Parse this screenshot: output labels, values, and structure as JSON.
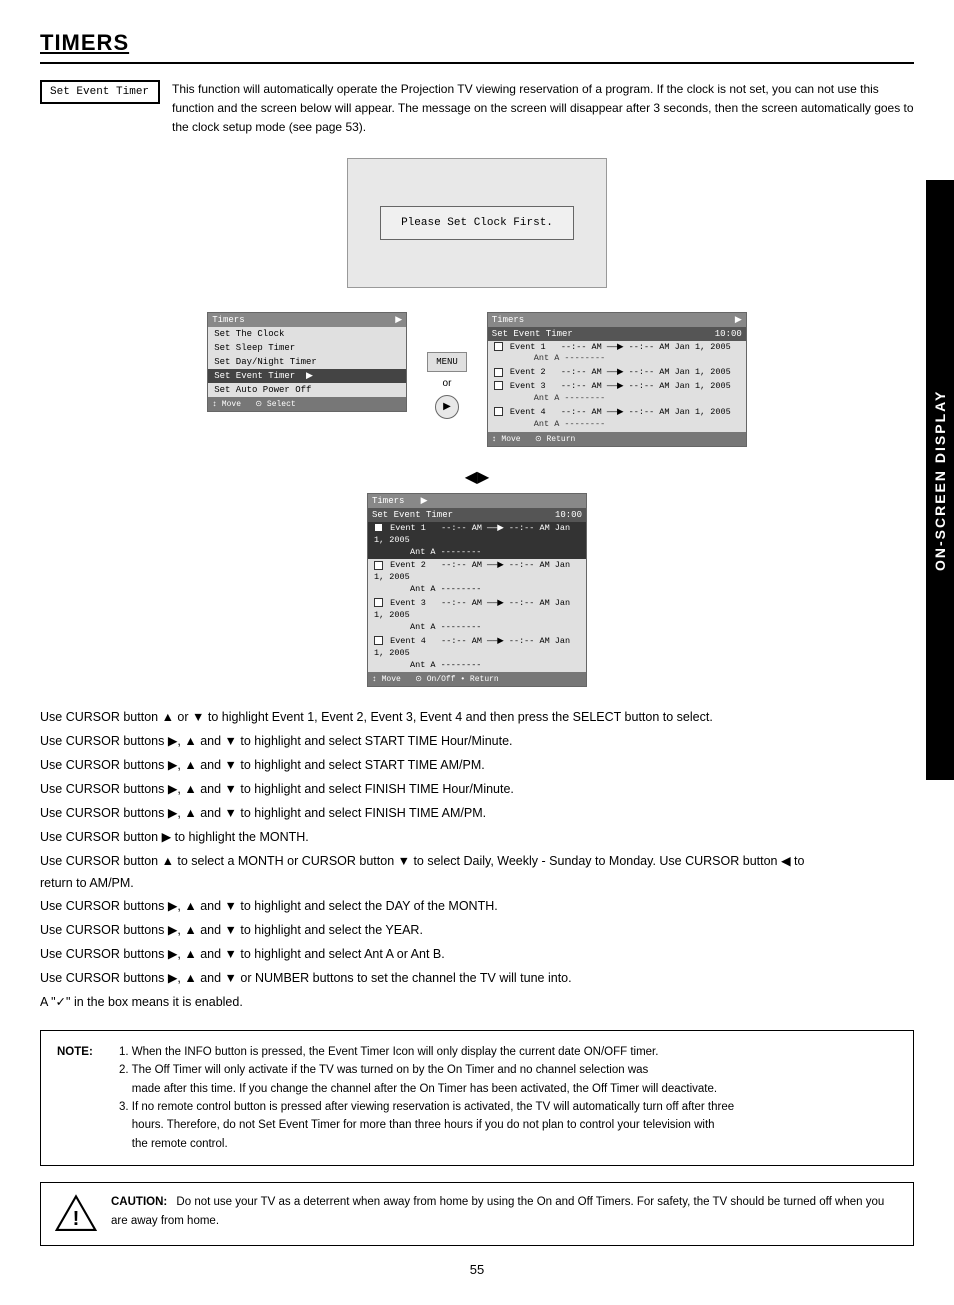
{
  "page": {
    "title": "TIMERS",
    "page_number": "55",
    "right_label": "ON-SCREEN DISPLAY"
  },
  "badge": {
    "label": "Set Event Timer"
  },
  "intro": {
    "text": "This function will automatically operate the Projection TV viewing reservation of a program.  If the clock is not set, you can not use this function and the screen below will appear.  The message on the screen will disappear after 3 seconds, then the screen automatically goes to the clock setup mode (see page 53)."
  },
  "clock_screen": {
    "message": "Please Set Clock First."
  },
  "menu": {
    "title": "Timers",
    "items": [
      {
        "label": "Set The Clock",
        "highlighted": false
      },
      {
        "label": "Set Sleep Timer",
        "highlighted": false
      },
      {
        "label": "Set Day/Night Timer",
        "highlighted": false
      },
      {
        "label": "Set Event Timer",
        "highlighted": true
      },
      {
        "label": "Set Auto Power Off",
        "highlighted": false
      }
    ],
    "bottom": "↕ Move  ⊙ Select"
  },
  "event_timer_right": {
    "title": "Timers",
    "subtitle": "Set Event Timer",
    "time": "10:00",
    "events": [
      {
        "num": 1,
        "time": "--:-- AM ——▶ --:-- AM Jan 1, 2005",
        "ant": "Ant A --------"
      },
      {
        "num": 2,
        "time": "--:-- AM ——▶ --:-- AM Jan 1, 2005",
        "ant": ""
      },
      {
        "num": 3,
        "time": "--:-- AM ——▶ --:-- AM Jan 1, 2005",
        "ant": "Ant A --------"
      },
      {
        "num": 4,
        "time": "--:-- AM ——▶ --:-- AM Jan 1, 2005",
        "ant": "Ant A --------"
      }
    ],
    "bottom": "↕ Move  ⊙ Return"
  },
  "event_timer_lower": {
    "title": "Timers",
    "subtitle": "Set Event Timer",
    "time": "10:00",
    "events": [
      {
        "num": 1,
        "time": "--:-- AM ——▶ --:-- AM Jan 1, 2005",
        "ant": "Ant A --------",
        "selected": true
      },
      {
        "num": 2,
        "time": "--:-- AM ——▶ --:-- AM Jan 1, 2005",
        "ant": "Ant A --------",
        "selected": false
      },
      {
        "num": 3,
        "time": "--:-- AM ——▶ --:-- AM Jan 1, 2005",
        "ant": "Ant A --------",
        "selected": false
      },
      {
        "num": 4,
        "time": "--:-- AM ——▶ --:-- AM Jan 1, 2005",
        "ant": "Ant A --------",
        "selected": false
      }
    ],
    "bottom": "↕ Move  ⊙ On/Off • Return"
  },
  "instructions": [
    "Use CURSOR button ▲ or ▼ to highlight Event 1, Event 2, Event 3, Event 4 and then press the SELECT button to select.",
    "Use CURSOR buttons ▶, ▲ and ▼ to highlight and select START TIME Hour/Minute.",
    "Use CURSOR buttons ▶, ▲ and ▼ to highlight and select START TIME AM/PM.",
    "Use CURSOR buttons ▶, ▲ and ▼ to highlight and select FINISH TIME Hour/Minute.",
    "Use CURSOR buttons ▶, ▲ and ▼ to highlight and select FINISH TIME AM/PM.",
    "Use CURSOR button ▶ to highlight the MONTH.",
    "Use CURSOR button ▲ to select a MONTH or CURSOR button ▼ to select Daily, Weekly - Sunday to Monday.  Use CURSOR button ◀ to return to AM/PM.",
    "Use CURSOR buttons ▶, ▲ and ▼ to highlight and select the DAY of the MONTH.",
    "Use CURSOR buttons ▶, ▲ and ▼ to highlight and select the YEAR.",
    "Use CURSOR buttons ▶, ▲ and ▼ to highlight and select Ant A or Ant B.",
    "Use CURSOR buttons ▶, ▲ and ▼ or NUMBER buttons to set the channel the TV will tune into.",
    "A \"✓\" in the box means it is enabled."
  ],
  "note": {
    "label": "NOTE:",
    "items": [
      "1. When the INFO button is pressed, the Event Timer Icon will only display the current date ON/OFF timer.",
      "2. The Off Timer will only activate if the TV was turned on by the On Timer and no channel selection was made after this time.  If you change the channel after the On Timer has been activated, the Off Timer will deactivate.",
      "3. If no remote control button is pressed after viewing reservation is activated, the TV will automatically turn off after three hours.  Therefore, do not Set Event Timer for more than three hours if you do not plan to control your television with the remote control."
    ]
  },
  "caution": {
    "label": "CAUTION:",
    "text": "Do not use your TV as a deterrent when away from home by using the On and Off Timers.  For safety, the TV should be turned off when you are away from home."
  }
}
